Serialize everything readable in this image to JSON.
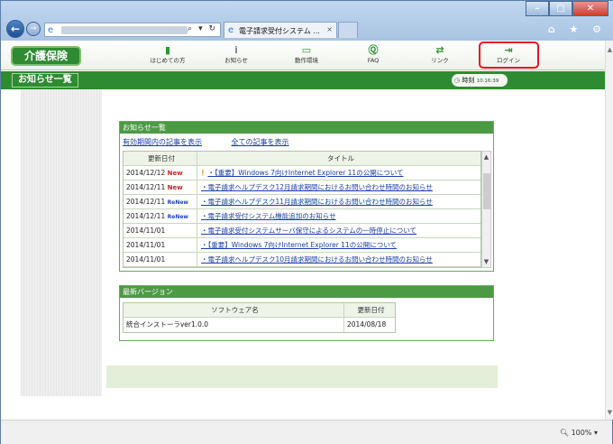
{
  "browser": {
    "tab_title": "電子請求受付システム ...",
    "tab_close": "×",
    "address_tools": "⌕ ▾ ↻",
    "window_buttons": {
      "min": "–",
      "max": "□",
      "close": "✕"
    },
    "toolbar_icons": "⌂ ★ ⚙",
    "back_glyph": "←",
    "forward_glyph": "→"
  },
  "app": {
    "brand": "介護保険",
    "nav": [
      {
        "label": "はじめての方",
        "icon": "book-icon",
        "glyph": "▮"
      },
      {
        "label": "お知らせ",
        "icon": "info-icon",
        "glyph": "ⅰ"
      },
      {
        "label": "動作環境",
        "icon": "monitor-icon",
        "glyph": "▭"
      },
      {
        "label": "FAQ",
        "icon": "faq-icon",
        "glyph": "Ⓠ"
      },
      {
        "label": "リンク",
        "icon": "link-icon",
        "glyph": "⇄"
      },
      {
        "label": "ログイン",
        "icon": "login-icon",
        "glyph": "⇥"
      }
    ],
    "page_title": "お知らせ一覧",
    "clock_label": "時刻",
    "clock_time": "10:16:39"
  },
  "news": {
    "heading": "お知らせ一覧",
    "filter_valid": "有効期間内の記事を表示",
    "filter_all": "全ての記事を表示",
    "columns": {
      "date": "更新日付",
      "title": "タイトル"
    },
    "rows": [
      {
        "date": "2014/12/12",
        "badge": "New",
        "excl": "！",
        "title": "・【重要】Windows 7向けInternet Explorer 11の公開について"
      },
      {
        "date": "2014/12/11",
        "badge": "New",
        "excl": "",
        "title": "・電子請求ヘルプデスク12月請求期間におけるお問い合わせ時間のお知らせ"
      },
      {
        "date": "2014/12/11",
        "badge": "ReNew",
        "excl": "",
        "title": "・電子請求ヘルプデスク11月請求期間におけるお問い合わせ時間のお知らせ"
      },
      {
        "date": "2014/12/11",
        "badge": "ReNew",
        "excl": "",
        "title": "・電子請求受付システム機能追加のお知らせ"
      },
      {
        "date": "2014/11/01",
        "badge": "",
        "excl": "",
        "title": "・電子請求受付システムサーバ保守によるシステムの一時停止について"
      },
      {
        "date": "2014/11/01",
        "badge": "",
        "excl": "",
        "title": "・【重要】Windows 7向けInternet Explorer 11の公開について"
      },
      {
        "date": "2014/11/01",
        "badge": "",
        "excl": "",
        "title": "・電子請求ヘルプデスク10月請求期間におけるお問い合わせ時間のお知らせ"
      }
    ]
  },
  "version": {
    "heading": "最新バージョン",
    "columns": {
      "name": "ソフトウェア名",
      "date": "更新日付"
    },
    "rows": [
      {
        "name": "統合インストーラver1.0.0",
        "date": "2014/08/18"
      }
    ]
  },
  "status": {
    "zoom": "100%",
    "zoom_glyph": "🔍︎"
  },
  "colors": {
    "brand_green": "#2e8b32",
    "highlight_red": "#e8141d",
    "new_red": "#d21f1f",
    "renew_blue": "#2345c6"
  }
}
